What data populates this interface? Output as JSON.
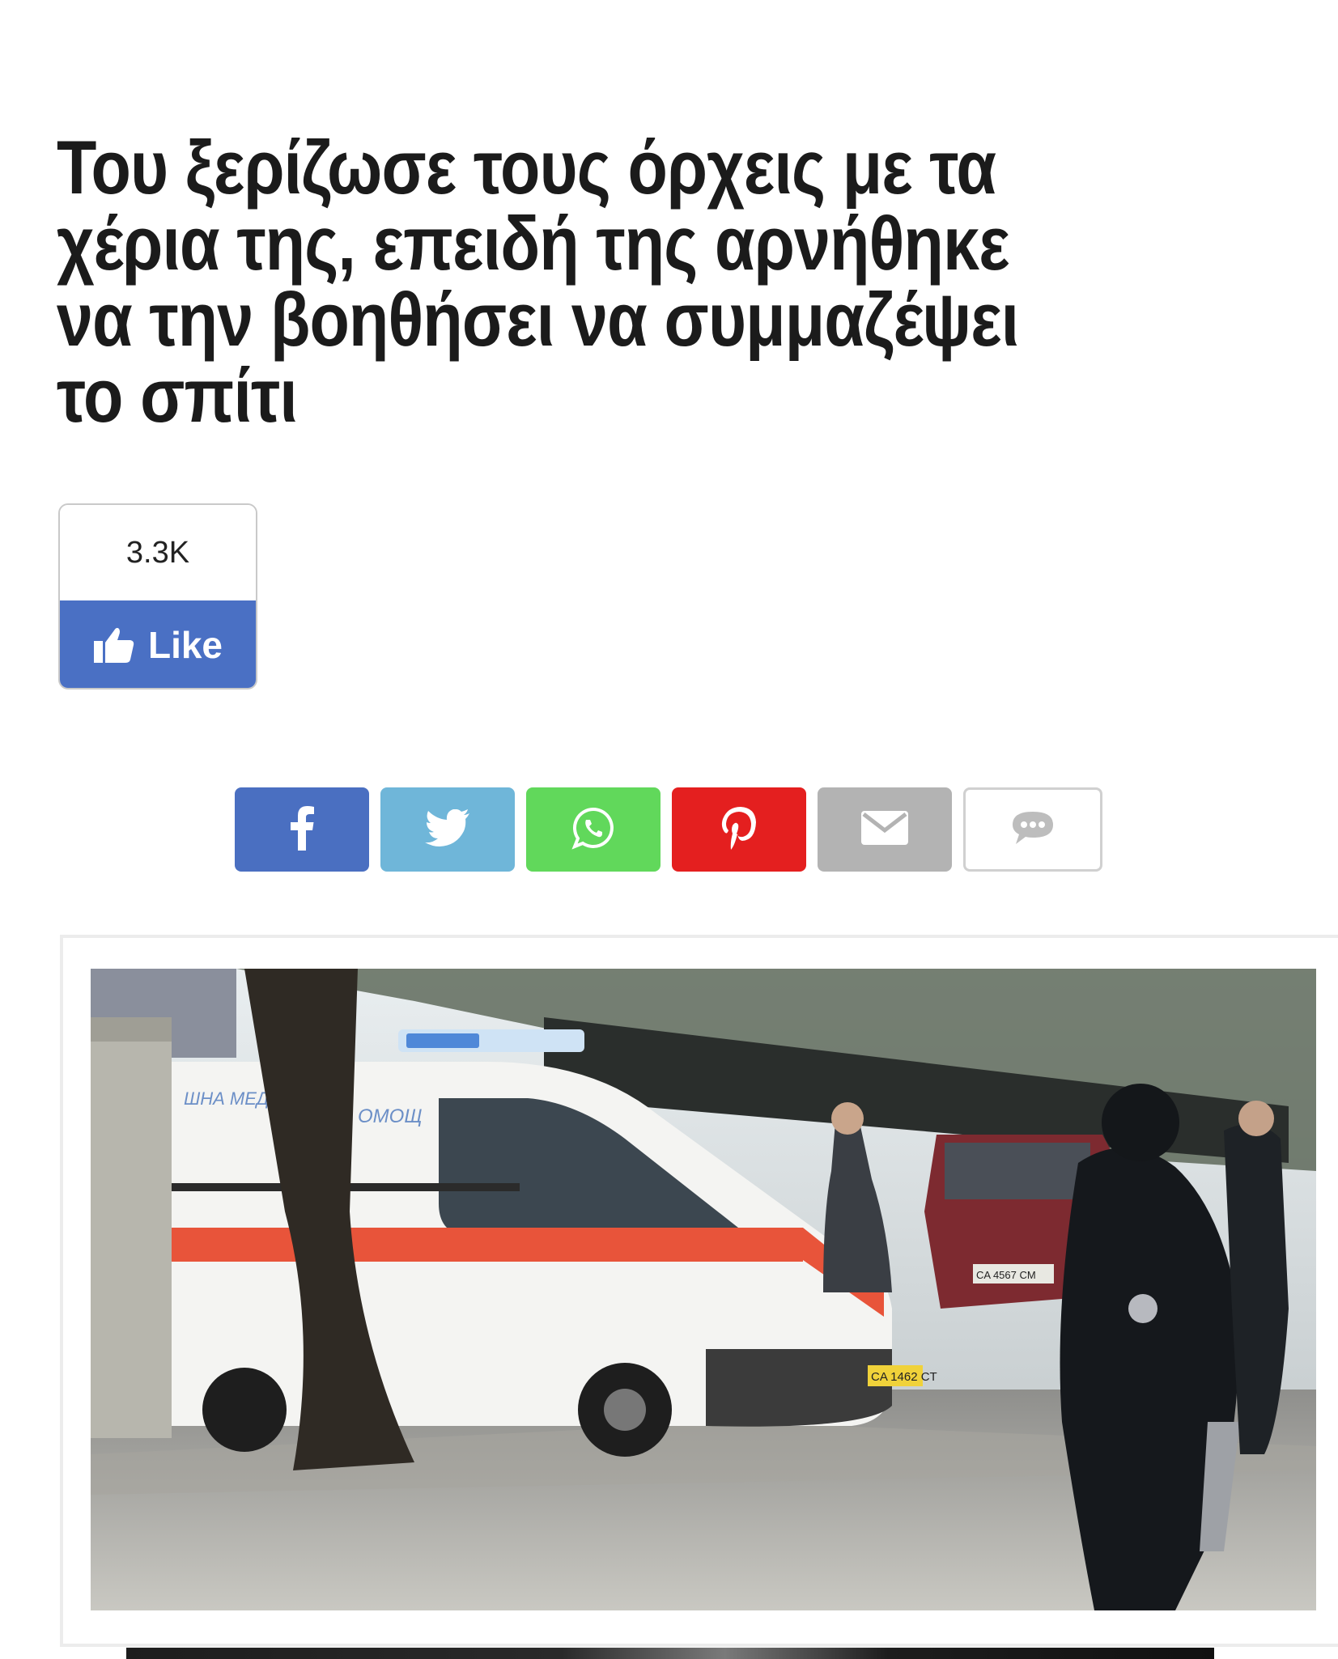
{
  "article": {
    "title": "Του ξερίζωσε τους όρχεις με τα χέρια της, επειδή της αρνήθηκε να την βοηθήσει να συμμαζέψει το σπίτι"
  },
  "facebook_like": {
    "count": "3.3K",
    "label": "Like",
    "color": "#4a70c4"
  },
  "share_buttons": [
    {
      "network": "facebook",
      "icon": "facebook-icon",
      "color": "#4a6fc1"
    },
    {
      "network": "twitter",
      "icon": "twitter-icon",
      "color": "#6fb6d9"
    },
    {
      "network": "whatsapp",
      "icon": "whatsapp-icon",
      "color": "#61d85b"
    },
    {
      "network": "pinterest",
      "icon": "pinterest-icon",
      "color": "#e41f1f"
    },
    {
      "network": "email",
      "icon": "mail-icon",
      "color": "#b3b3b3"
    },
    {
      "network": "comment",
      "icon": "comment-icon",
      "color": "#ffffff"
    }
  ],
  "photo": {
    "vehicle_text_left": "ШНА МЕД",
    "vehicle_text_right": "ОМОЩ",
    "plate": "CA 1462 CT",
    "car_plate": "CA 4567 CM"
  }
}
